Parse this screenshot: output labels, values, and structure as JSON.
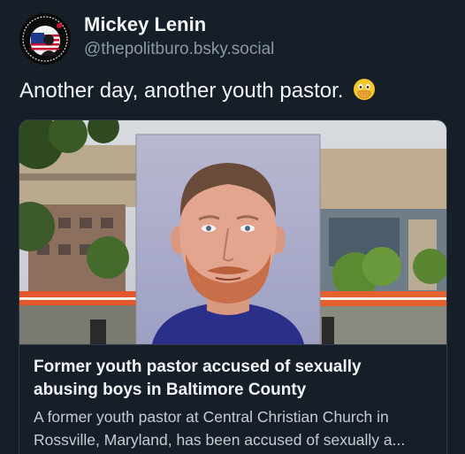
{
  "author": {
    "name": "Mickey Lenin",
    "handle": "@thepolitburo.bsky.social"
  },
  "post": {
    "text": "Another day, another youth pastor.",
    "emoji": "face-with-open-eyes-and-hand-over-mouth"
  },
  "link_card": {
    "title_line1": "Former youth pastor accused of sexually",
    "title_line2": "abusing boys in Baltimore County",
    "desc_line1": "A former youth pastor at Central Christian Church in",
    "desc_line2": "Rossville, Maryland, has been accused of sexually a..."
  },
  "colors": {
    "background": "#161e27",
    "text_primary": "#f1f3f5",
    "text_secondary": "#8b98a5",
    "card_border": "#2e3a47"
  }
}
